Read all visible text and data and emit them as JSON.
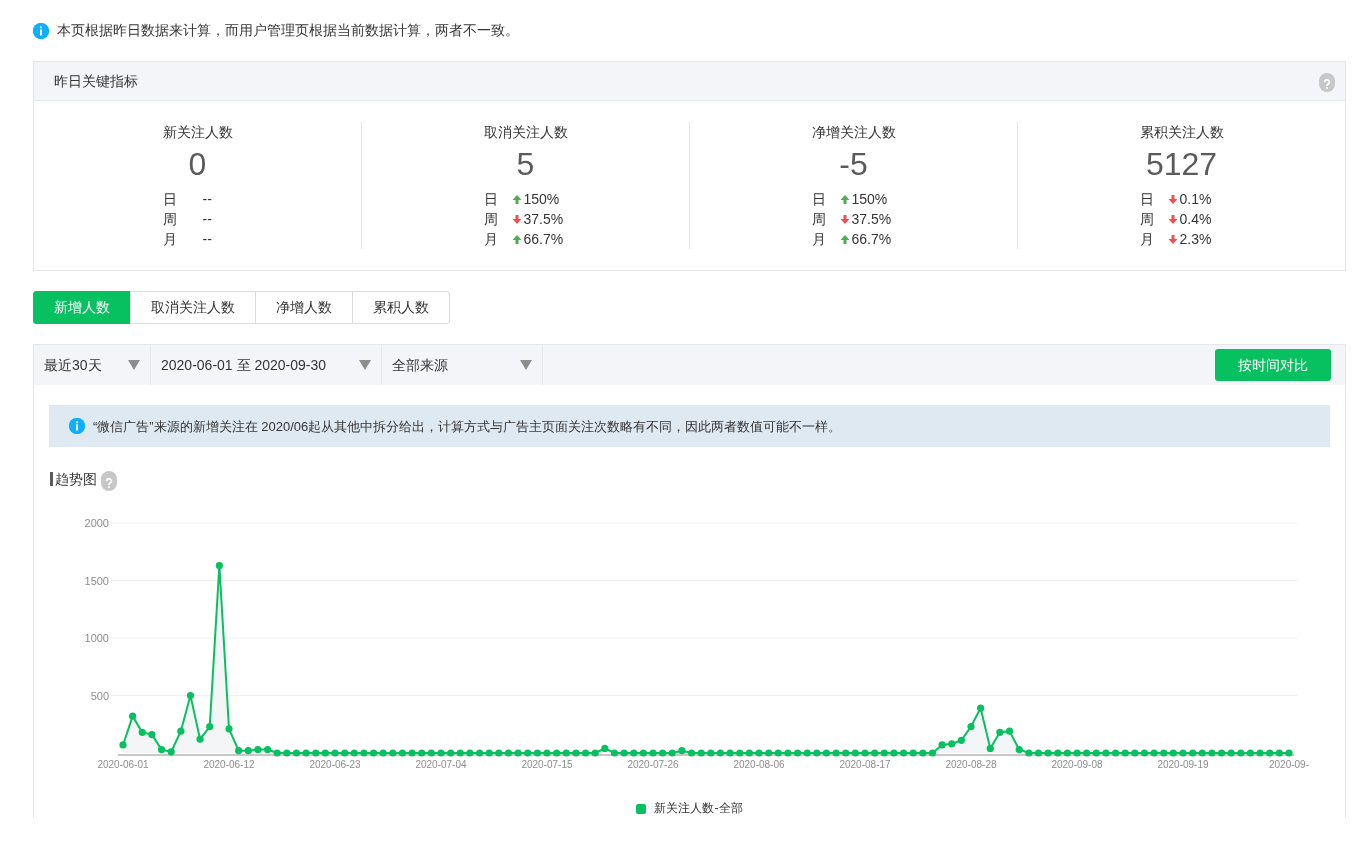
{
  "notice": "本页根据昨日数据来计算，而用户管理页根据当前数据计算，两者不一致。",
  "key_metrics": {
    "title": "昨日关键指标",
    "metrics": [
      {
        "label": "新关注人数",
        "value": "0",
        "changes": [
          {
            "period": "日",
            "value": "--"
          },
          {
            "period": "周",
            "value": "--"
          },
          {
            "period": "月",
            "value": "--"
          }
        ]
      },
      {
        "label": "取消关注人数",
        "value": "5",
        "changes": [
          {
            "period": "日",
            "increase": true,
            "value": "150%"
          },
          {
            "period": "周",
            "increase": false,
            "value": "37.5%"
          },
          {
            "period": "月",
            "increase": true,
            "value": "66.7%"
          }
        ]
      },
      {
        "label": "净增关注人数",
        "value": "-5",
        "changes": [
          {
            "period": "日",
            "increase": true,
            "value": "150%"
          },
          {
            "period": "周",
            "increase": false,
            "value": "37.5%"
          },
          {
            "period": "月",
            "increase": true,
            "value": "66.7%"
          }
        ]
      },
      {
        "label": "累积关注人数",
        "value": "5127",
        "changes": [
          {
            "period": "日",
            "increase": false,
            "value": "0.1%"
          },
          {
            "period": "周",
            "increase": false,
            "value": "0.4%"
          },
          {
            "period": "月",
            "increase": false,
            "value": "2.3%"
          }
        ]
      }
    ]
  },
  "tabs": [
    {
      "label": "新增人数",
      "selected": true
    },
    {
      "label": "取消关注人数",
      "selected": false
    },
    {
      "label": "净增人数",
      "selected": false
    },
    {
      "label": "累积人数",
      "selected": false
    }
  ],
  "filters": [
    {
      "value": "最近30天"
    },
    {
      "value": "2020-06-01 至 2020-09-30"
    },
    {
      "value": "全部来源"
    }
  ],
  "compare_button": "按时间对比",
  "info_banner": "“微信广告”来源的新增关注在 2020/06起从其他中拆分给出，计算方式与广告主页面关注次数略有不同，因此两者数值可能不一样。",
  "trend": {
    "title": "趋势图",
    "chart_data": {
      "type": "line",
      "categories": [
        "2020-06-01",
        null,
        null,
        null,
        null,
        null,
        null,
        null,
        null,
        null,
        null,
        "2020-06-12",
        null,
        null,
        null,
        null,
        null,
        null,
        null,
        null,
        null,
        null,
        "2020-06-23",
        null,
        null,
        null,
        null,
        null,
        null,
        null,
        null,
        null,
        null,
        "2020-07-04",
        null,
        null,
        null,
        null,
        null,
        null,
        null,
        null,
        null,
        null,
        "2020-07-15",
        null,
        null,
        null,
        null,
        null,
        null,
        null,
        null,
        null,
        null,
        "2020-07-26",
        null,
        null,
        null,
        null,
        null,
        null,
        null,
        null,
        null,
        null,
        "2020-08-06",
        null,
        null,
        null,
        null,
        null,
        null,
        null,
        null,
        null,
        null,
        "2020-08-17",
        null,
        null,
        null,
        null,
        null,
        null,
        null,
        null,
        null,
        null,
        "2020-08-28",
        null,
        null,
        null,
        null,
        null,
        null,
        null,
        null,
        null,
        null,
        "2020-09-08",
        null,
        null,
        null,
        null,
        null,
        null,
        null,
        null,
        null,
        null,
        "2020-09-19",
        null,
        null,
        null,
        null,
        null,
        null,
        null,
        null,
        null,
        null,
        "2020-09-"
      ],
      "series": [
        {
          "name": "新关注人数-全部",
          "color": "#07c160",
          "marker": true,
          "values": [
            70,
            320,
            180,
            160,
            30,
            10,
            190,
            500,
            120,
            230,
            1630,
            210,
            20,
            20,
            30,
            30,
            0,
            0,
            0,
            0,
            0,
            0,
            0,
            0,
            0,
            0,
            0,
            0,
            0,
            0,
            0,
            0,
            0,
            0,
            0,
            0,
            0,
            0,
            0,
            0,
            0,
            0,
            0,
            0,
            0,
            0,
            0,
            0,
            0,
            0,
            40,
            0,
            0,
            0,
            0,
            0,
            0,
            0,
            20,
            0,
            0,
            0,
            0,
            0,
            0,
            0,
            0,
            0,
            0,
            0,
            0,
            0,
            0,
            0,
            0,
            0,
            0,
            0,
            0,
            0,
            0,
            0,
            0,
            0,
            0,
            70,
            80,
            110,
            230,
            390,
            40,
            180,
            190,
            30,
            0,
            0,
            0,
            0,
            0,
            0,
            0,
            0,
            0,
            0,
            0,
            0,
            0,
            0,
            0,
            0,
            0,
            0,
            0,
            0,
            0,
            0,
            0,
            0,
            0,
            0,
            0,
            0
          ]
        }
      ],
      "ylim": [
        0,
        2000
      ],
      "yticks": [
        500,
        1000,
        1500,
        2000
      ],
      "grid": true
    }
  }
}
